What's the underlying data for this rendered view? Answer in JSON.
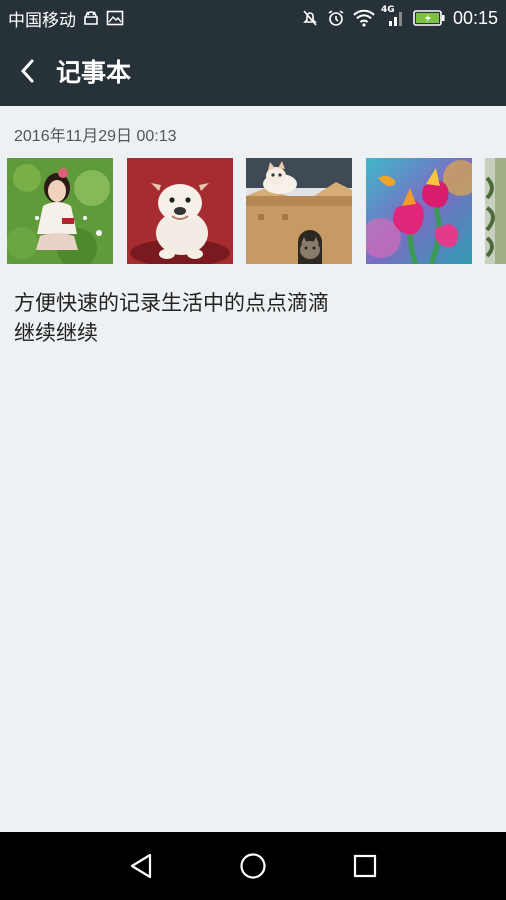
{
  "status_bar": {
    "carrier": "中国移动",
    "network_type": "4G",
    "time": "00:15",
    "icons": [
      "android-notify-icon",
      "image-notify-icon",
      "mute-icon",
      "alarm-icon",
      "wifi-icon",
      "signal-icon",
      "battery-charging-icon"
    ]
  },
  "app_bar": {
    "title": "记事本",
    "back_icon": "chevron-left-icon"
  },
  "note": {
    "date": "2016年11月29日 00:13",
    "images": [
      "girl-on-grass-photo",
      "white-bulldog-puppy-photo",
      "cats-in-cardboard-box-photo",
      "pink-flowers-photo",
      "partial-photo"
    ],
    "lines": [
      "方便快速的记录生活中的点点滴滴",
      "继续继续"
    ]
  },
  "nav_bar": {
    "buttons": [
      "back-triangle-icon",
      "home-circle-icon",
      "recent-square-icon"
    ]
  },
  "colors": {
    "header_bg": "#263238",
    "content_bg": "#eef1f3",
    "nav_bg": "#000000"
  }
}
